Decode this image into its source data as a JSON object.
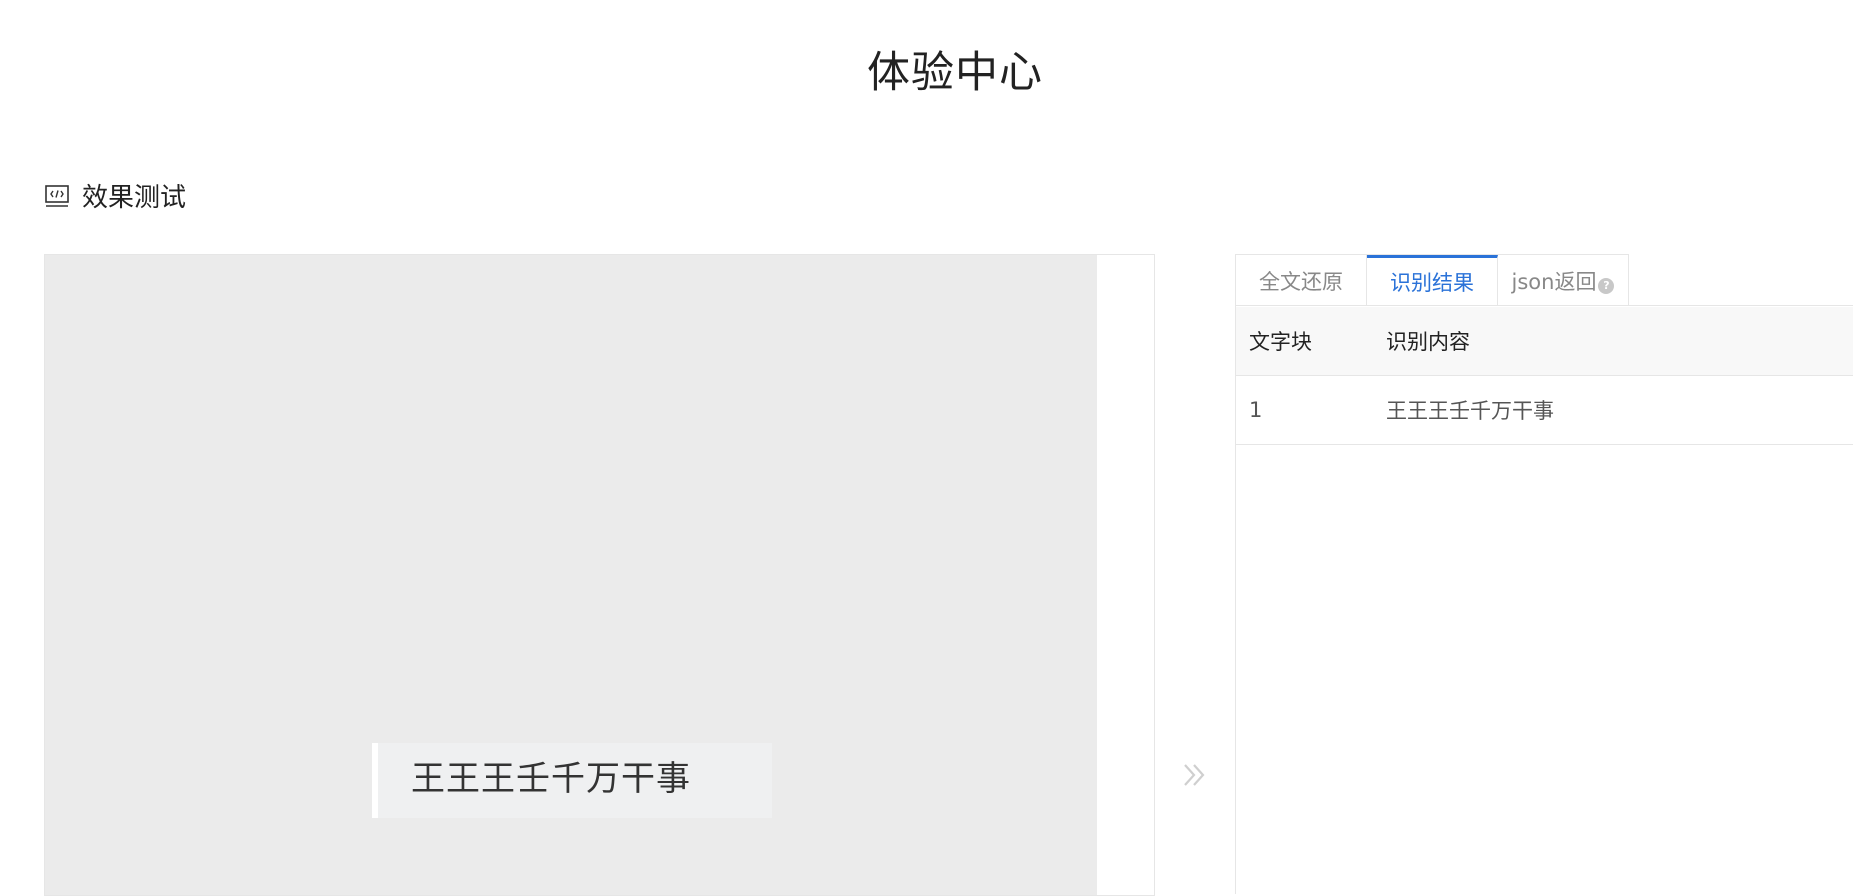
{
  "page": {
    "title": "体验中心"
  },
  "section": {
    "title": "效果测试",
    "icon": "code-window-icon"
  },
  "preview": {
    "recognized_text": "王王王壬千万干事"
  },
  "arrow": {
    "icon": "double-chevron-right-icon"
  },
  "tabs": [
    {
      "label": "全文还原",
      "active": false
    },
    {
      "label": "识别结果",
      "active": true
    },
    {
      "label": "json返回",
      "active": false,
      "icon": "help-icon",
      "icon_glyph": "?"
    }
  ],
  "table": {
    "headers": [
      "文字块",
      "识别内容"
    ],
    "rows": [
      {
        "index": "1",
        "content": "王王王壬千万干事"
      }
    ]
  },
  "colors": {
    "accent": "#2a72d8",
    "canvas_bg": "#ebebeb",
    "border": "#e6e6e6"
  }
}
